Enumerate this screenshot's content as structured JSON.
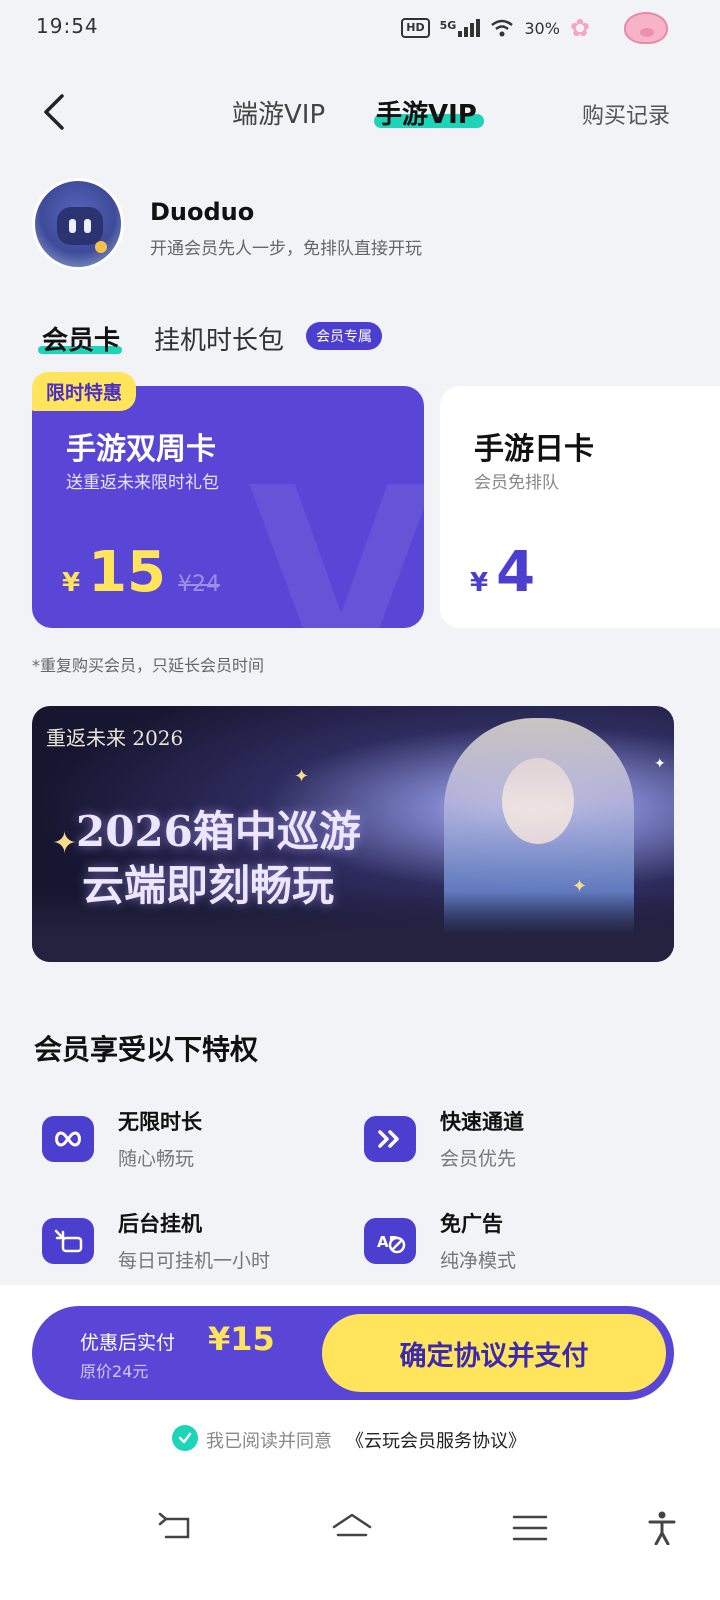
{
  "status_bar": {
    "time": "19:54",
    "hd": "HD",
    "network": "5G",
    "battery": "30%"
  },
  "header": {
    "tab_pc": "端游VIP",
    "tab_mobile": "手游VIP",
    "purchase_record": "购买记录"
  },
  "profile": {
    "username": "Duoduo",
    "subtitle": "开通会员先人一步，免排队直接开玩"
  },
  "card_tabs": {
    "member_card": "会员卡",
    "idle_pack": "挂机时长包",
    "exclusive_badge": "会员专属"
  },
  "plans": [
    {
      "tag": "限时特惠",
      "title": "手游双周卡",
      "desc": "送重返未来限时礼包",
      "currency": "¥",
      "price": "15",
      "original": "¥24",
      "selected": true
    },
    {
      "title": "手游日卡",
      "desc": "会员免排队",
      "currency": "¥",
      "price": "4",
      "selected": false
    }
  ],
  "repeat_note": "*重复购买会员，只延长会员时间",
  "banner": {
    "logo": "重返未来 2026",
    "line1": "2026箱中巡游",
    "line2": "云端即刻畅玩"
  },
  "privileges": {
    "title": "会员享受以下特权",
    "items": [
      {
        "icon": "infinity-icon",
        "name": "无限时长",
        "desc": "随心畅玩"
      },
      {
        "icon": "fast-forward-icon",
        "name": "快速通道",
        "desc": "会员优先"
      },
      {
        "icon": "picture-in-picture-icon",
        "name": "后台挂机",
        "desc": "每日可挂机一小时"
      },
      {
        "icon": "no-ads-icon",
        "name": "免广告",
        "desc": "纯净模式"
      }
    ]
  },
  "pay": {
    "label": "优惠后实付",
    "amount": "¥15",
    "original": "原价24元",
    "button": "确定协议并支付"
  },
  "agreement": {
    "text": "我已阅读并同意",
    "link": "《云玩会员服务协议》",
    "checked": true
  },
  "colors": {
    "brand_purple": "#5a46d6",
    "accent_yellow": "#ffe45c",
    "accent_teal": "#1ed4b8"
  }
}
